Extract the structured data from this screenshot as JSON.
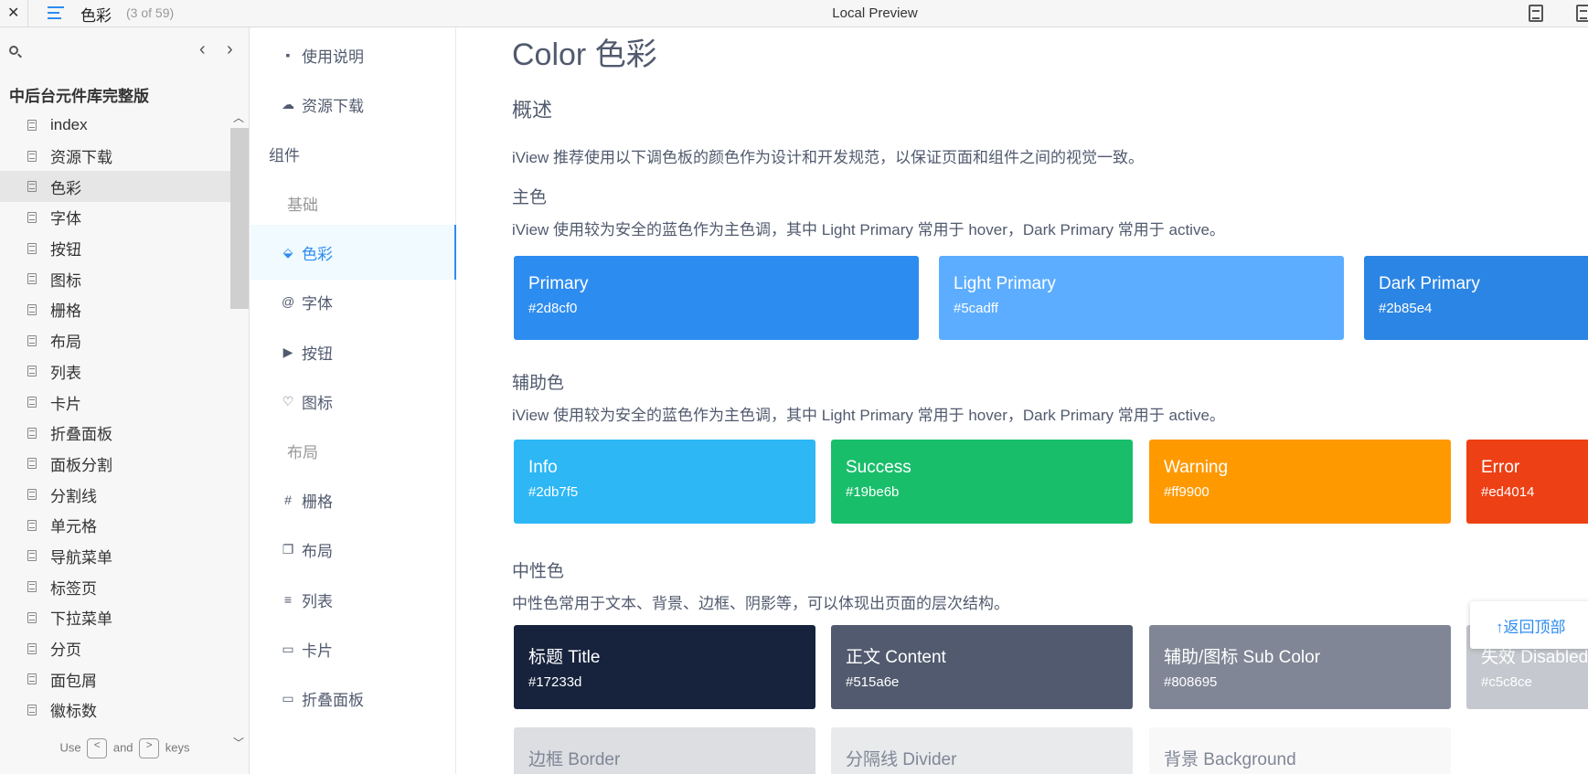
{
  "topbar": {
    "close": "✕",
    "doc_title": "色彩",
    "doc_count": "(3 of 59)",
    "center_title": "Local Preview"
  },
  "sidebar": {
    "heading": "中后台元件库完整版",
    "items": [
      "index",
      "资源下载",
      "色彩",
      "字体",
      "按钮",
      "图标",
      "栅格",
      "布局",
      "列表",
      "卡片",
      "折叠面板",
      "面板分割",
      "分割线",
      "单元格",
      "导航菜单",
      "标签页",
      "下拉菜单",
      "分页",
      "面包屑",
      "徽标数"
    ],
    "active_index": 2,
    "footer": {
      "use": "Use",
      "and": "and",
      "keys": "keys",
      "key_prev": "<",
      "key_next": ">"
    }
  },
  "docnav": {
    "items": [
      {
        "label": "使用说明",
        "icon": "book-icon",
        "glyph": "▪",
        "kind": "item"
      },
      {
        "label": "资源下载",
        "icon": "cloud-download-icon",
        "glyph": "☁",
        "kind": "item"
      },
      {
        "label": "组件",
        "kind": "group"
      },
      {
        "label": "基础",
        "kind": "sub"
      },
      {
        "label": "色彩",
        "icon": "paint-bucket-icon",
        "glyph": "⬙",
        "kind": "item",
        "active": true
      },
      {
        "label": "字体",
        "icon": "at-icon",
        "glyph": "@",
        "kind": "item"
      },
      {
        "label": "按钮",
        "icon": "play-icon",
        "glyph": "▶",
        "kind": "item"
      },
      {
        "label": "图标",
        "icon": "heart-icon",
        "glyph": "♡",
        "kind": "item"
      },
      {
        "label": "布局",
        "kind": "sub"
      },
      {
        "label": "栅格",
        "icon": "grid-icon",
        "glyph": "#",
        "kind": "item"
      },
      {
        "label": "布局",
        "icon": "copy-icon",
        "glyph": "❐",
        "kind": "item"
      },
      {
        "label": "列表",
        "icon": "list-icon",
        "glyph": "≡",
        "kind": "item"
      },
      {
        "label": "卡片",
        "icon": "card-icon",
        "glyph": "▭",
        "kind": "item"
      },
      {
        "label": "折叠面板",
        "icon": "collapse-icon",
        "glyph": "▭",
        "kind": "item"
      }
    ]
  },
  "main": {
    "title": "Color 色彩",
    "overview": "概述",
    "overview_text": "iView 推荐使用以下调色板的颜色作为设计和开发规范，以保证页面和组件之间的视觉一致。",
    "primary": {
      "heading": "主色",
      "desc": "iView 使用较为安全的蓝色作为主色调，其中 Light Primary 常用于 hover，Dark Primary 常用于 active。",
      "colors": [
        {
          "name": "Primary",
          "code": "#2d8cf0",
          "color": "#2d8cf0"
        },
        {
          "name": "Light Primary",
          "code": "#5cadff",
          "color": "#5cadff"
        },
        {
          "name": "Dark Primary",
          "code": "#2b85e4",
          "color": "#2b85e4"
        }
      ]
    },
    "aux": {
      "heading": "辅助色",
      "desc": "iView 使用较为安全的蓝色作为主色调，其中 Light Primary 常用于 hover，Dark Primary 常用于 active。",
      "colors": [
        {
          "name": "Info",
          "code": "#2db7f5",
          "color": "#2db7f5"
        },
        {
          "name": "Success",
          "code": "#19be6b",
          "color": "#19be6b"
        },
        {
          "name": "Warning",
          "code": "#ff9900",
          "color": "#ff9900"
        },
        {
          "name": "Error",
          "code": "#ed4014",
          "color": "#ed4014"
        }
      ]
    },
    "neutral": {
      "heading": "中性色",
      "desc": "中性色常用于文本、背景、边框、阴影等，可以体现出页面的层次结构。",
      "colors": [
        {
          "name": "标题 Title",
          "code": "#17233d",
          "color": "#17233d"
        },
        {
          "name": "正文 Content",
          "code": "#515a6e",
          "color": "#515a6e"
        },
        {
          "name": "辅助/图标 Sub Color",
          "code": "#808695",
          "color": "#808695"
        },
        {
          "name": "失效 Disabled",
          "code": "#c5c8ce",
          "color": "#c5c8ce"
        }
      ],
      "light_colors": [
        {
          "name": "边框 Border",
          "color": "#dcdee2"
        },
        {
          "name": "分隔线 Divider",
          "color": "#e8eaec"
        },
        {
          "name": "背景 Background",
          "color": "#f8f8f9"
        }
      ]
    },
    "back_top": "返回顶部"
  }
}
